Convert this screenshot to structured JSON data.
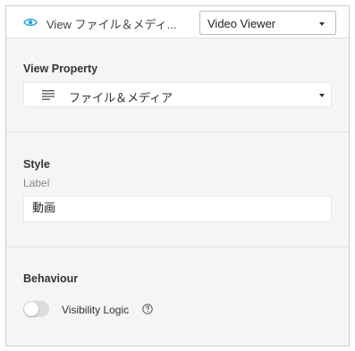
{
  "header": {
    "title": "View ファイル＆メディ...",
    "viewer_select": {
      "value": "Video Viewer"
    }
  },
  "view_property": {
    "title": "View Property",
    "select_value": "ファイル＆メディア"
  },
  "style": {
    "title": "Style",
    "label_caption": "Label",
    "label_value": "動画"
  },
  "behaviour": {
    "title": "Behaviour",
    "visibility_logic_label": "Visibility Logic",
    "visibility_logic_on": false
  },
  "icons": {
    "eye": "eye-icon",
    "lines": "lines-icon",
    "help": "help-circle-icon",
    "caret": "chevron-down-icon"
  },
  "colors": {
    "accent": "#2aa8d8",
    "toggle_off": "#dcdcdc"
  }
}
